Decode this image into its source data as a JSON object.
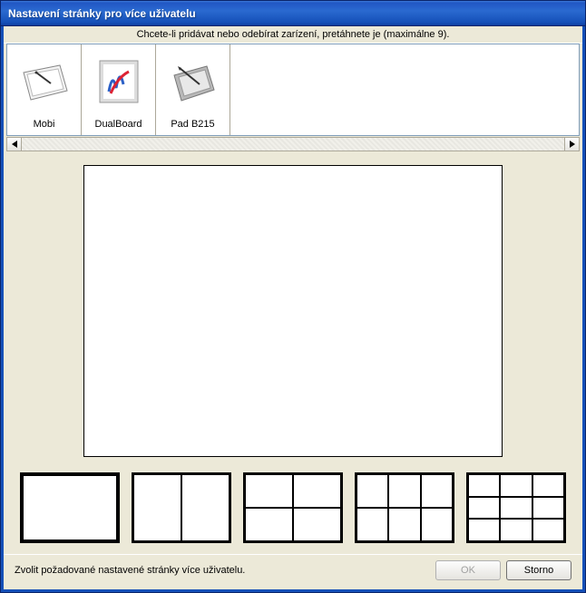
{
  "window": {
    "title": "Nastavení stránky pro více uživatelu"
  },
  "instruction": "Chcete-li pridávat nebo odebírat zarízení, pretáhnete je (maximálne 9).",
  "devices": [
    {
      "label": "Mobi"
    },
    {
      "label": "DualBoard"
    },
    {
      "label": "Pad B215"
    }
  ],
  "layouts": [
    {
      "name": "layout-1",
      "selected": true
    },
    {
      "name": "layout-2",
      "selected": false
    },
    {
      "name": "layout-4",
      "selected": false
    },
    {
      "name": "layout-6",
      "selected": false
    },
    {
      "name": "layout-9",
      "selected": false
    }
  ],
  "footer": {
    "hint": "Zvolit požadované nastavené stránky více uživatelu.",
    "ok": "OK",
    "cancel": "Storno"
  }
}
